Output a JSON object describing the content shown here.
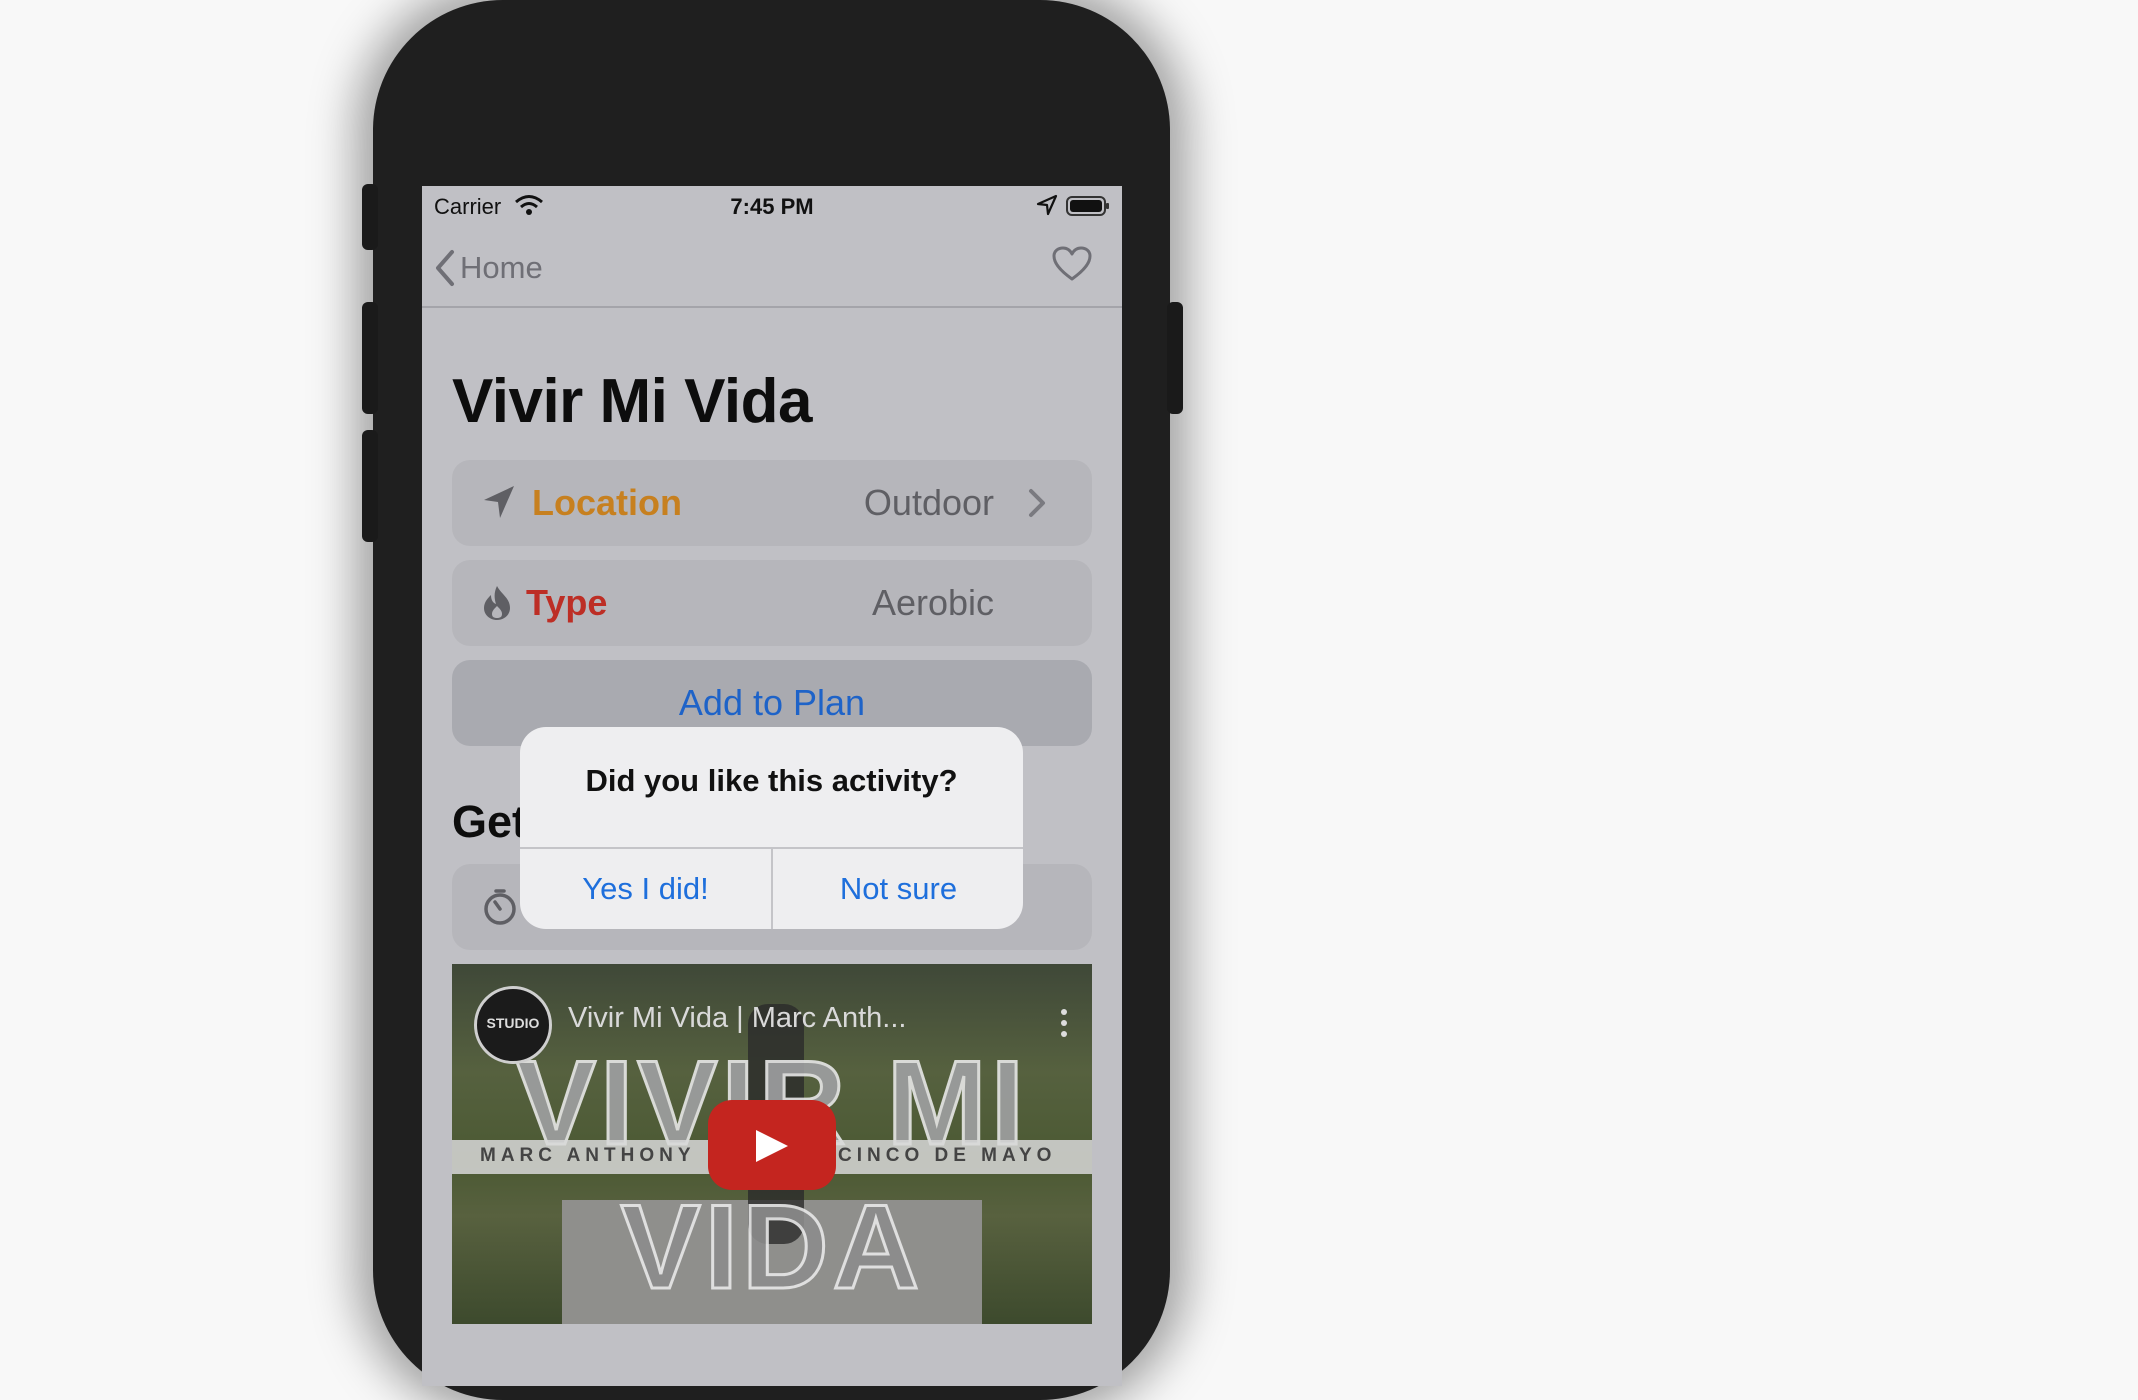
{
  "status_bar": {
    "carrier": "Carrier",
    "time": "7:45 PM"
  },
  "nav": {
    "back_label": "Home"
  },
  "activity": {
    "title": "Vivir Mi Vida",
    "location_label": "Location",
    "location_value": "Outdoor",
    "type_label": "Type",
    "type_value": "Aerobic",
    "add_to_plan": "Add to Plan",
    "section_partial": "Get"
  },
  "video": {
    "title": "Vivir Mi Vida | Marc Anth...",
    "logo_text": "STUDIO",
    "overlay_line1": "VIVIR MI",
    "overlay_band_left": "MARC ANTHONY",
    "overlay_band_right": "CINCO DE MAYO",
    "overlay_line2": "VIDA"
  },
  "alert": {
    "message": "Did you like this activity?",
    "yes_button": "Yes I did!",
    "no_button": "Not sure"
  },
  "colors": {
    "location_accent": "#c7801f",
    "type_accent": "#bd2e25",
    "link_blue": "#1e63c8",
    "alert_button_blue": "#1e6fdc"
  }
}
